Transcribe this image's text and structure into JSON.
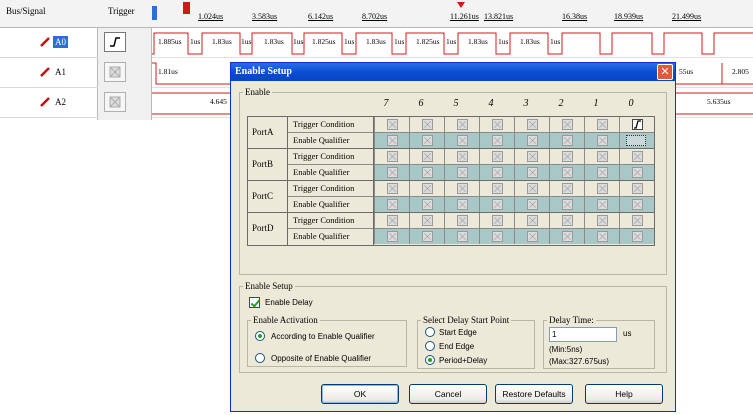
{
  "analyzer": {
    "headers": {
      "bus_signal": "Bus/Signal",
      "trigger": "Trigger"
    },
    "signals": [
      {
        "label": "A0",
        "selected": true
      },
      {
        "label": "A1",
        "selected": false
      },
      {
        "label": "A2",
        "selected": false
      }
    ],
    "timeline": [
      "1.024us",
      "3.583us",
      "6.142us",
      "8.702us",
      "11.261us",
      "13.821us",
      "16.38us",
      "18.939us",
      "21.499us"
    ],
    "wave_a0": [
      "1.885us",
      "1us",
      "1.83us",
      "1us",
      "1.83us",
      "1us",
      "1.825us",
      "1us",
      "1.83us",
      "1us",
      "1.825us",
      "1us",
      "1.83us",
      "1us",
      "1.83us",
      "1us"
    ],
    "wave_a1": {
      "left": "1.81us",
      "right": "55us",
      "far": "2.805"
    },
    "wave_a2": {
      "left": "4.645",
      "right": "5.635us"
    }
  },
  "dialog": {
    "title": "Enable Setup",
    "enable_group": "Enable",
    "columns": [
      "7",
      "6",
      "5",
      "4",
      "3",
      "2",
      "1",
      "0"
    ],
    "ports": [
      {
        "name": "PortA",
        "rows": [
          "Trigger Condition",
          "Enable Qualifier"
        ]
      },
      {
        "name": "PortB",
        "rows": [
          "Trigger Condition",
          "Enable Qualifier"
        ]
      },
      {
        "name": "PortC",
        "rows": [
          "Trigger Condition",
          "Enable Qualifier"
        ]
      },
      {
        "name": "PortD",
        "rows": [
          "Trigger Condition",
          "Enable Qualifier"
        ]
      }
    ],
    "setup": {
      "group": "Enable Setup",
      "enable_delay_label": "Enable Delay",
      "enable_delay_checked": true,
      "activation": {
        "group": "Enable Activation",
        "options": [
          "According to Enable Qualifier",
          "Opposite of Enable Qualifier"
        ],
        "selected": 0
      },
      "delay_start": {
        "group": "Select Delay Start Point",
        "options": [
          "Start Edge",
          "End Edge",
          "Period+Delay"
        ],
        "selected": 2
      },
      "delay_time": {
        "group": "Delay Time:",
        "value": "1",
        "unit": "us",
        "min": "(Min:5ns)",
        "max": "(Max:327.675us)"
      }
    },
    "buttons": {
      "ok": "OK",
      "cancel": "Cancel",
      "restore": "Restore Defaults",
      "help": "Help"
    }
  },
  "colors": {
    "title_bar": "#0a4bd2",
    "selection": "#2b6ed8",
    "qualifier_cell": "#a8c8c8",
    "wave_red": "#d01818"
  }
}
